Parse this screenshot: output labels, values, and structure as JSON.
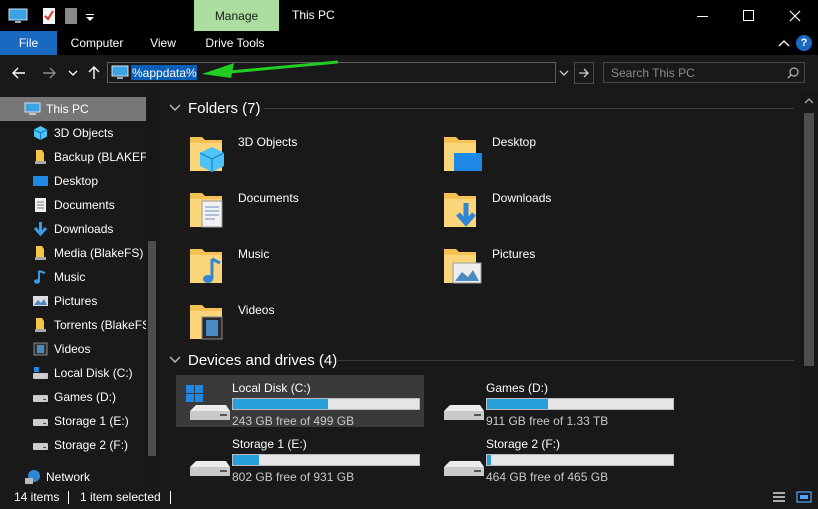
{
  "window": {
    "title": "This PC",
    "contextual_tab": "Manage",
    "minimize_icon": "minimize-icon",
    "maximize_icon": "maximize-icon",
    "close_icon": "close-icon"
  },
  "ribbon": {
    "tabs": [
      {
        "label": "File",
        "active": true
      },
      {
        "label": "Computer"
      },
      {
        "label": "View"
      },
      {
        "label": "Drive Tools"
      }
    ],
    "accent": "#1a69c1",
    "manage_color": "#aadfa0"
  },
  "address": {
    "value": "%appdata%",
    "search_placeholder": "Search This PC"
  },
  "nav": {
    "items": [
      {
        "label": "This PC",
        "icon": "pc-icon",
        "selected": true
      },
      {
        "label": "3D Objects",
        "icon": "cube-icon"
      },
      {
        "label": "Backup (BLAKEF",
        "icon": "network-folder-icon"
      },
      {
        "label": "Desktop",
        "icon": "desktop-icon"
      },
      {
        "label": "Documents",
        "icon": "document-icon"
      },
      {
        "label": "Downloads",
        "icon": "download-icon"
      },
      {
        "label": "Media (BlakeFS)",
        "icon": "network-folder-icon"
      },
      {
        "label": "Music",
        "icon": "music-icon"
      },
      {
        "label": "Pictures",
        "icon": "picture-icon"
      },
      {
        "label": "Torrents (BlakeFS",
        "icon": "network-folder-icon"
      },
      {
        "label": "Videos",
        "icon": "video-icon"
      },
      {
        "label": "Local Disk (C:)",
        "icon": "system-drive-icon"
      },
      {
        "label": "Games (D:)",
        "icon": "drive-icon"
      },
      {
        "label": "Storage 1 (E:)",
        "icon": "drive-icon"
      },
      {
        "label": "Storage 2 (F:)",
        "icon": "drive-icon"
      },
      {
        "label": "Network",
        "icon": "network-icon"
      }
    ]
  },
  "folders": {
    "header": "Folders (7)",
    "items": [
      {
        "name": "3D Objects",
        "overlay": "cube"
      },
      {
        "name": "Desktop",
        "overlay": "desktop"
      },
      {
        "name": "Documents",
        "overlay": "document"
      },
      {
        "name": "Downloads",
        "overlay": "download"
      },
      {
        "name": "Music",
        "overlay": "music"
      },
      {
        "name": "Pictures",
        "overlay": "picture"
      },
      {
        "name": "Videos",
        "overlay": "video"
      }
    ]
  },
  "drives": {
    "header": "Devices and drives (4)",
    "items": [
      {
        "name": "Local Disk (C:)",
        "free": "243 GB free of 499 GB",
        "used_fraction": 0.51,
        "system": true,
        "selected": true
      },
      {
        "name": "Games (D:)",
        "free": "911 GB free of 1.33 TB",
        "used_fraction": 0.33
      },
      {
        "name": "Storage 1 (E:)",
        "free": "802 GB free of 931 GB",
        "used_fraction": 0.14
      },
      {
        "name": "Storage 2 (F:)",
        "free": "464 GB free of 465 GB",
        "used_fraction": 0.02
      }
    ],
    "bar_color": "#26a0da"
  },
  "status": {
    "count": "14 items",
    "selected": "1 item selected"
  },
  "annotation": {
    "arrow_color": "#22cc22"
  }
}
